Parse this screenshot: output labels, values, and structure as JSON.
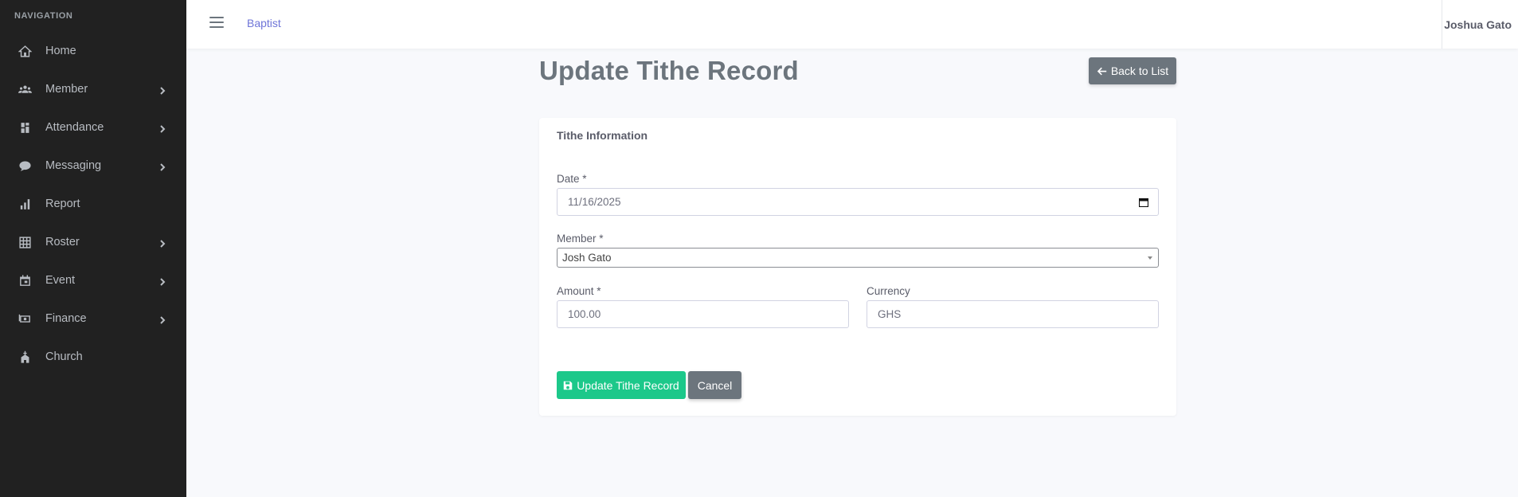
{
  "sidebar": {
    "heading": "NAVIGATION",
    "items": [
      {
        "label": "Home",
        "icon": "home-icon",
        "has_submenu": false
      },
      {
        "label": "Member",
        "icon": "users-icon",
        "has_submenu": true
      },
      {
        "label": "Attendance",
        "icon": "clipboard-check-icon",
        "has_submenu": true
      },
      {
        "label": "Messaging",
        "icon": "comment-icon",
        "has_submenu": true
      },
      {
        "label": "Report",
        "icon": "bar-chart-icon",
        "has_submenu": false
      },
      {
        "label": "Roster",
        "icon": "roster-grid-icon",
        "has_submenu": true
      },
      {
        "label": "Event",
        "icon": "calendar-icon",
        "has_submenu": true
      },
      {
        "label": "Finance",
        "icon": "money-bill-icon",
        "has_submenu": true
      },
      {
        "label": "Church",
        "icon": "church-icon",
        "has_submenu": false
      }
    ]
  },
  "topbar": {
    "brand": "Baptist",
    "user_name": "Joshua Gato"
  },
  "page": {
    "title": "Update Tithe Record",
    "back_button": "Back to List"
  },
  "form": {
    "card_title": "Tithe Information",
    "date_label": "Date *",
    "date_value": "11/16/2025",
    "member_label": "Member *",
    "member_value": "Josh Gato",
    "amount_label": "Amount *",
    "amount_value": "100.00",
    "currency_label": "Currency",
    "currency_value": "GHS",
    "submit_label": "Update Tithe Record",
    "cancel_label": "Cancel"
  },
  "colors": {
    "sidebar_bg": "#212121",
    "primary_success": "#1cc88a",
    "secondary": "#6c757d",
    "brand_link": "#6f75d8"
  }
}
